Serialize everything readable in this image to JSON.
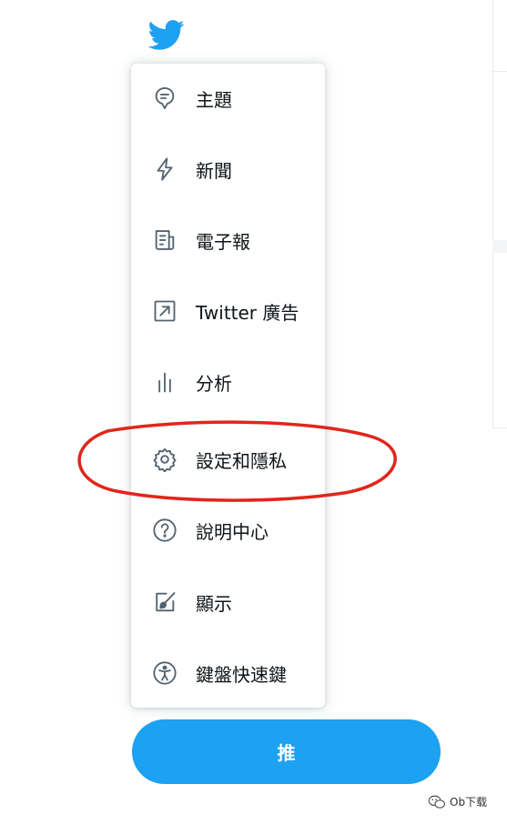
{
  "menu": {
    "items": [
      {
        "label": "主題",
        "icon": "topics-icon"
      },
      {
        "label": "新聞",
        "icon": "lightning-icon"
      },
      {
        "label": "電子報",
        "icon": "newsletter-icon"
      },
      {
        "label": "Twitter 廣告",
        "icon": "external-arrow-icon"
      },
      {
        "label": "分析",
        "icon": "analytics-icon"
      },
      {
        "label": "設定和隱私",
        "icon": "gear-icon"
      },
      {
        "label": "說明中心",
        "icon": "help-icon"
      },
      {
        "label": "顯示",
        "icon": "display-icon"
      },
      {
        "label": "鍵盤快速鍵",
        "icon": "accessibility-icon"
      }
    ]
  },
  "tweet_button": {
    "label": "推"
  },
  "watermark": {
    "text": "Ob下载"
  },
  "colors": {
    "brand": "#1da1f2",
    "icon": "#536471",
    "annotation": "#e0261b"
  }
}
